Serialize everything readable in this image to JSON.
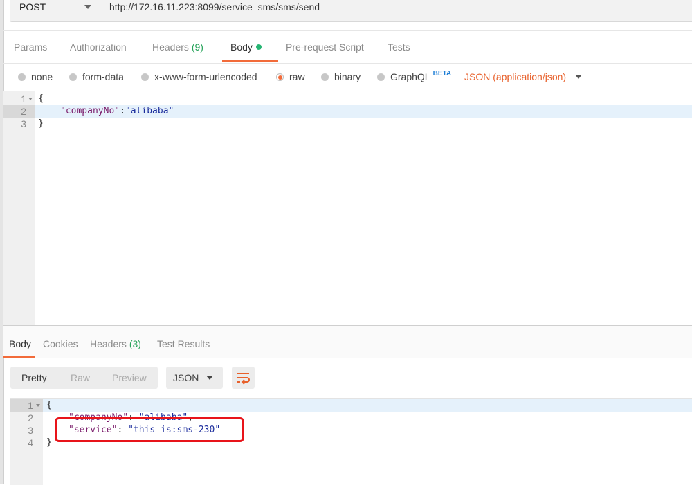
{
  "request": {
    "method": "POST",
    "url": "http://172.16.11.223:8099/service_sms/sms/send"
  },
  "request_tabs": [
    {
      "label": "Params"
    },
    {
      "label": "Authorization"
    },
    {
      "label": "Headers",
      "count": "(9)"
    },
    {
      "label": "Body"
    },
    {
      "label": "Pre-request Script"
    },
    {
      "label": "Tests"
    }
  ],
  "body_types": [
    {
      "label": "none"
    },
    {
      "label": "form-data"
    },
    {
      "label": "x-www-form-urlencoded"
    },
    {
      "label": "raw",
      "selected": true
    },
    {
      "label": "binary"
    },
    {
      "label": "GraphQL",
      "badge": "BETA"
    }
  ],
  "content_type": "JSON (application/json)",
  "request_body": {
    "line_numbers": [
      "1",
      "2",
      "3"
    ],
    "open_brace": "{",
    "key": "\"companyNo\"",
    "colon": ":",
    "value": "\"alibaba\"",
    "close_brace": "}"
  },
  "response_tabs": [
    {
      "label": "Body"
    },
    {
      "label": "Cookies"
    },
    {
      "label": "Headers",
      "count": "(3)"
    },
    {
      "label": "Test Results"
    }
  ],
  "view_modes": [
    "Pretty",
    "Raw",
    "Preview"
  ],
  "format": "JSON",
  "response_body": {
    "line_numbers": [
      "1",
      "2",
      "3",
      "4"
    ],
    "open_brace": "{",
    "key1": "\"companyNo\"",
    "value1": "\"alibaba\"",
    "key2": "\"service\"",
    "value2": "\"this is:sms-230\"",
    "close_brace": "}",
    "separator": ": ",
    "comma": ","
  },
  "colors": {
    "accent": "#f26b3a",
    "tab_count": "#26a35a",
    "callout": "#e8141a"
  }
}
